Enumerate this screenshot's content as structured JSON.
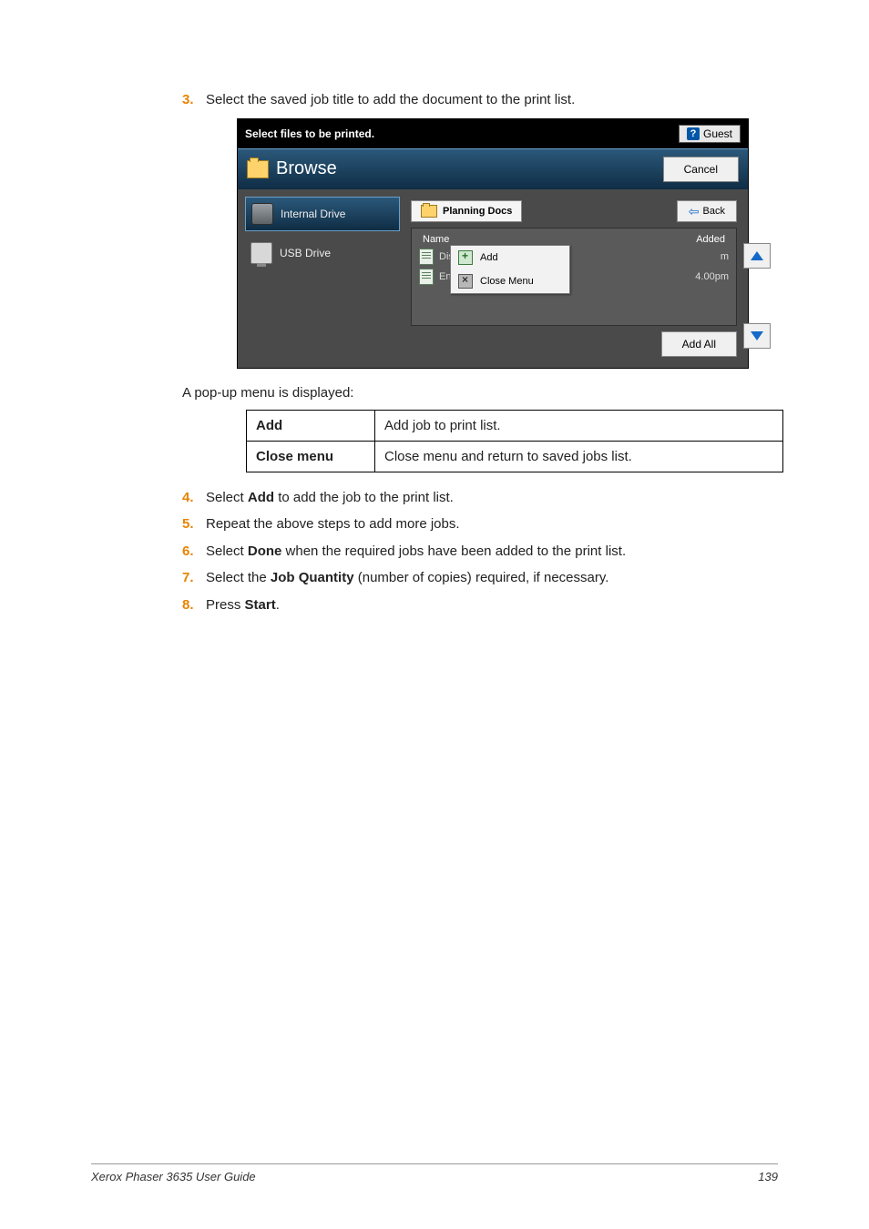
{
  "steps": {
    "s3_num": "3.",
    "s3_text": "Select the saved job title to add the document to the print list.",
    "s4_num": "4.",
    "s4_text_a": "Select ",
    "s4_bold": "Add",
    "s4_text_b": " to add the job to the print list.",
    "s5_num": "5.",
    "s5_text": "Repeat the above steps to add more jobs.",
    "s6_num": "6.",
    "s6_text_a": "Select ",
    "s6_bold": "Done",
    "s6_text_b": " when the required jobs have been added to the print list.",
    "s7_num": "7.",
    "s7_text_a": "Select the ",
    "s7_bold": "Job Quantity",
    "s7_text_b": " (number of copies) required, if necessary.",
    "s8_num": "8.",
    "s8_text_a": "Press ",
    "s8_bold": "Start",
    "s8_text_b": "."
  },
  "para_popup": "A pop-up menu is displayed:",
  "popup_table": {
    "r1_key": "Add",
    "r1_val": "Add job to print list.",
    "r2_key": "Close menu",
    "r2_val": "Close menu and return to saved jobs list."
  },
  "screen": {
    "titlebar": "Select files to be printed.",
    "guest_label": "Guest",
    "browse_label": "Browse",
    "cancel_label": "Cancel",
    "drives": {
      "internal": "Internal Drive",
      "usb": "USB Drive"
    },
    "path_label": "Planning Docs",
    "back_label": "Back",
    "list_header_name": "Name",
    "list_header_added": "Added",
    "row1_name": "Dis",
    "row1_added": "m",
    "row2_name": "Endeavors",
    "row2_added": "4.00pm",
    "popup_add": "Add",
    "popup_close": "Close Menu",
    "addall_label": "Add All"
  },
  "footer": {
    "left": "Xerox Phaser 3635 User Guide",
    "right": "139"
  }
}
